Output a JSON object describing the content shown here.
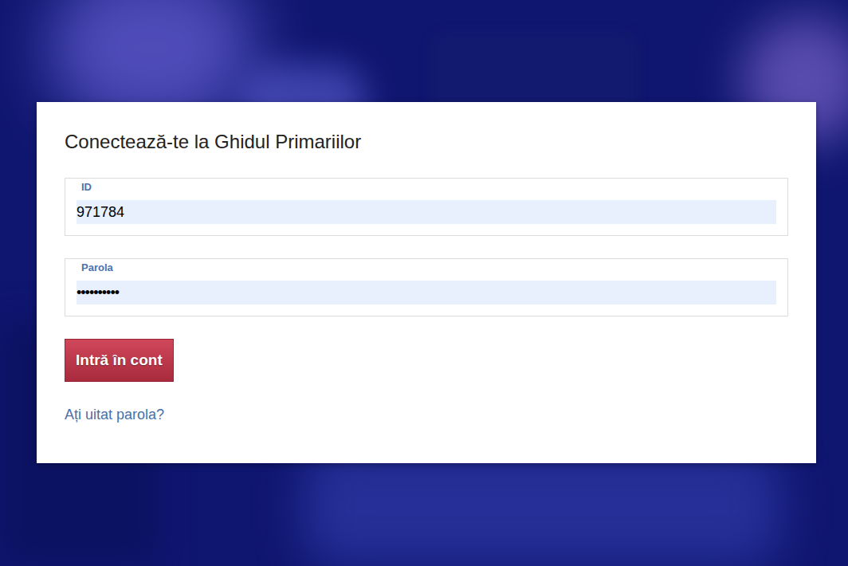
{
  "title": "Conectează-te la Ghidul Primariilor",
  "fields": [
    {
      "label": "ID",
      "value": "971784",
      "kind": "text"
    },
    {
      "label": "Parola",
      "value": "••••••••••",
      "kind": "password"
    }
  ],
  "button": "Intră în cont",
  "forgot_link": "Ați uitat parola?"
}
